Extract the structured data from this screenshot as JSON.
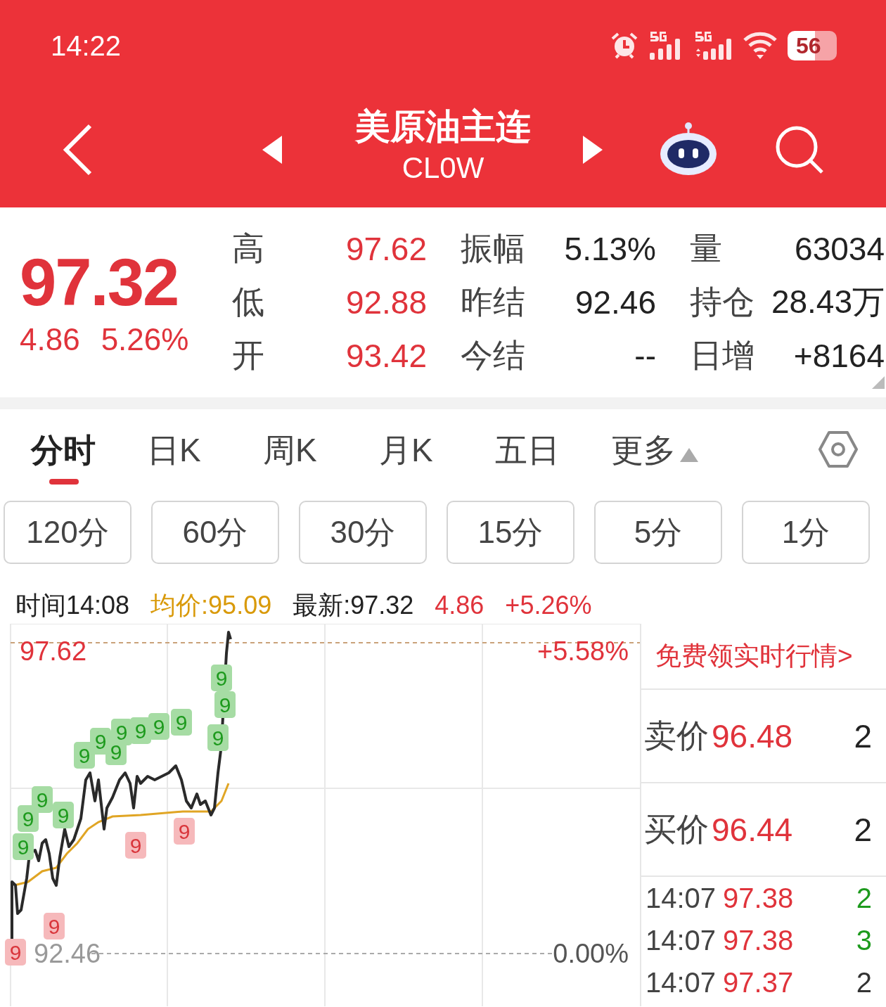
{
  "status_bar": {
    "time": "14:22",
    "battery": "56"
  },
  "header": {
    "title": "美原油主连",
    "code": "CL0W"
  },
  "quote": {
    "price": "97.32",
    "change": "4.86",
    "change_pct": "5.26%",
    "stats": [
      [
        {
          "label": "高",
          "value": "97.62",
          "color": "#e0333b"
        },
        {
          "label": "振幅",
          "value": "5.13%",
          "color": "#222222"
        },
        {
          "label": "量",
          "value": "63034",
          "color": "#222222"
        }
      ],
      [
        {
          "label": "低",
          "value": "92.88",
          "color": "#e0333b"
        },
        {
          "label": "昨结",
          "value": "92.46",
          "color": "#222222"
        },
        {
          "label": "持仓",
          "value": "28.43万",
          "color": "#222222"
        }
      ],
      [
        {
          "label": "开",
          "value": "93.42",
          "color": "#e0333b"
        },
        {
          "label": "今结",
          "value": "--",
          "color": "#222222"
        },
        {
          "label": "日增",
          "value": "+8164",
          "color": "#222222"
        }
      ]
    ]
  },
  "tabs": [
    {
      "label": "分时",
      "selected": true,
      "has_menu": false
    },
    {
      "label": "日K",
      "selected": false,
      "has_menu": false
    },
    {
      "label": "周K",
      "selected": false,
      "has_menu": false
    },
    {
      "label": "月K",
      "selected": false,
      "has_menu": false
    },
    {
      "label": "五日",
      "selected": false,
      "has_menu": false
    },
    {
      "label": "更多",
      "selected": false,
      "has_menu": true
    }
  ],
  "periods": [
    "120分",
    "60分",
    "30分",
    "15分",
    "5分",
    "1分"
  ],
  "chart": {
    "time": "时间14:08",
    "avg": "均价:95.09",
    "latest": "最新:97.32",
    "change": "4.86",
    "change_pct": "+5.58%",
    "info_pct": "+5.26%",
    "high": "97.62",
    "base": "92.46",
    "base_pct": "0.00%",
    "markers": [
      {
        "text": "9",
        "kind": "buy"
      },
      {
        "text": "9",
        "kind": "buy"
      },
      {
        "text": "9",
        "kind": "buy"
      },
      {
        "text": "9",
        "kind": "buy"
      },
      {
        "text": "9",
        "kind": "buy"
      },
      {
        "text": "9",
        "kind": "buy"
      },
      {
        "text": "9",
        "kind": "buy"
      },
      {
        "text": "9",
        "kind": "buy"
      },
      {
        "text": "9",
        "kind": "buy"
      },
      {
        "text": "9",
        "kind": "buy"
      },
      {
        "text": "9",
        "kind": "buy"
      },
      {
        "text": "9",
        "kind": "buy"
      },
      {
        "text": "9",
        "kind": "buy"
      },
      {
        "text": "9",
        "kind": "buy"
      },
      {
        "text": "9",
        "kind": "sell"
      },
      {
        "text": "9",
        "kind": "sell"
      },
      {
        "text": "9",
        "kind": "sell"
      },
      {
        "text": "9",
        "kind": "sell"
      }
    ]
  },
  "side": {
    "promo": "免费领实时行情>",
    "ask": {
      "label": "卖价",
      "price": "96.48",
      "volume": "2"
    },
    "bid": {
      "label": "买价",
      "price": "96.44",
      "volume": "2"
    },
    "trades": [
      {
        "time": "14:07",
        "price": "97.38",
        "volume": "2",
        "color": "#1d9a1d"
      },
      {
        "time": "14:07",
        "price": "97.38",
        "volume": "3",
        "color": "#1d9a1d"
      },
      {
        "time": "14:07",
        "price": "97.37",
        "volume": "2",
        "color": "#333333"
      }
    ]
  }
}
